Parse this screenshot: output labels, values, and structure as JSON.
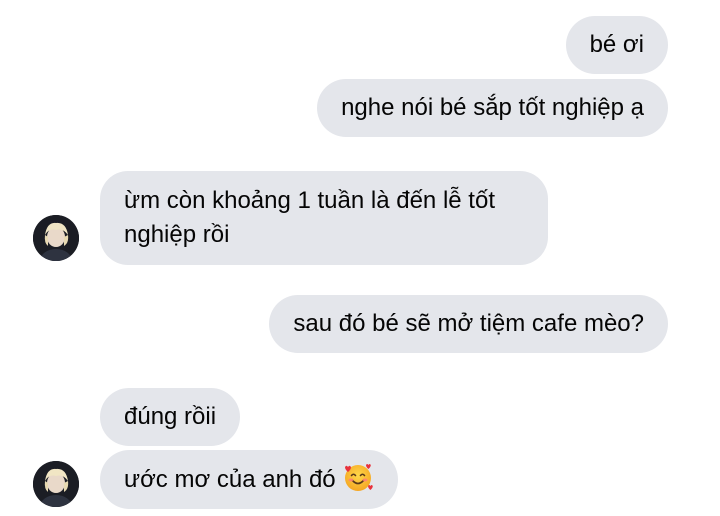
{
  "conversation": {
    "messages": [
      {
        "sender": "me",
        "text": "bé ơi"
      },
      {
        "sender": "me",
        "text": "nghe nói bé sắp tốt nghiệp ạ"
      },
      {
        "sender": "them",
        "text": "ừm còn khoảng 1 tuần là đến lễ tốt nghiệp rồi"
      },
      {
        "sender": "me",
        "text": "sau đó bé sẽ mở tiệm cafe mèo?"
      },
      {
        "sender": "them",
        "text": "đúng rồii"
      },
      {
        "sender": "them",
        "text": "ước mơ của anh đó",
        "emoji": "smiling-face-with-hearts-icon"
      }
    ]
  },
  "colors": {
    "bubble_background": "#e4e6eb",
    "text": "#050505",
    "page_background": "#ffffff"
  }
}
